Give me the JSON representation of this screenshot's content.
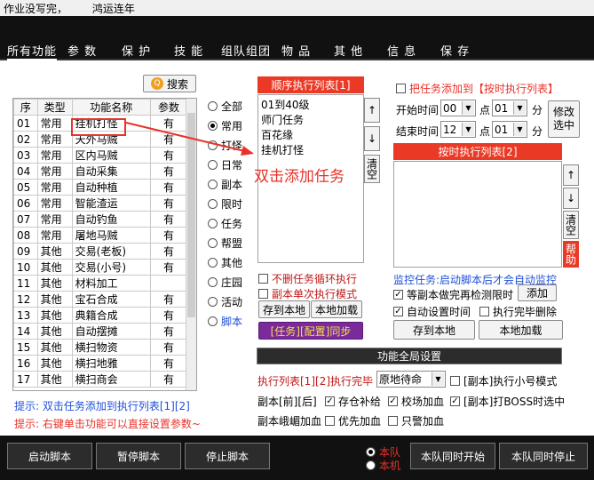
{
  "window": {
    "title_left": "作业没写完，",
    "title_right": "鸿运连年"
  },
  "tabs": [
    "所有功能",
    "参 数",
    "保 护",
    "技 能",
    "组队组团",
    "物 品",
    "其 他",
    "信 息",
    "保 存"
  ],
  "search_button": "搜索",
  "table": {
    "headers": [
      "序",
      "类型",
      "功能名称",
      "参数"
    ],
    "rows": [
      [
        "01",
        "常用",
        "挂机打怪",
        "有"
      ],
      [
        "02",
        "常用",
        "天外马贼",
        "有"
      ],
      [
        "03",
        "常用",
        "区内马贼",
        "有"
      ],
      [
        "04",
        "常用",
        "自动采集",
        "有"
      ],
      [
        "05",
        "常用",
        "自动种植",
        "有"
      ],
      [
        "06",
        "常用",
        "智能渣运",
        "有"
      ],
      [
        "07",
        "常用",
        "自动钓鱼",
        "有"
      ],
      [
        "08",
        "常用",
        "屠地马贼",
        "有"
      ],
      [
        "09",
        "其他",
        "交易(老板)",
        "有"
      ],
      [
        "10",
        "其他",
        "交易(小号)",
        "有"
      ],
      [
        "11",
        "其他",
        "材料加工",
        ""
      ],
      [
        "12",
        "其他",
        "宝石合成",
        "有"
      ],
      [
        "13",
        "其他",
        "典籍合成",
        "有"
      ],
      [
        "14",
        "其他",
        "自动摆摊",
        "有"
      ],
      [
        "15",
        "其他",
        "横扫物资",
        "有"
      ],
      [
        "16",
        "其他",
        "横扫地雅",
        "有"
      ],
      [
        "17",
        "其他",
        "横扫商会",
        "有"
      ]
    ]
  },
  "category_radios": {
    "items": [
      "全部",
      "常用",
      "打怪",
      "日常",
      "副本",
      "限时",
      "任务",
      "帮盟",
      "其他",
      "庄园",
      "活动",
      "脚本"
    ],
    "selected": "常用"
  },
  "sequence_list": {
    "title": "顺序执行列表[1]",
    "items": [
      "01到40级",
      "师门任务",
      "百花缘",
      "挂机打怪"
    ],
    "clear_label": "清空"
  },
  "annotation": {
    "text": "双击添加任务",
    "color": "#e8322a"
  },
  "timed": {
    "add_checkbox": "把任务添加到【按时执行列表】",
    "start_label": "开始时间",
    "start_hour": "00",
    "start_min": "01",
    "end_label": "结束时间",
    "end_hour": "12",
    "end_min": "01",
    "point": "点",
    "minute": "分",
    "modify_button": "修改选中",
    "list_title": "按时执行列表[2]",
    "clear_label": "清空",
    "help_label": "帮助"
  },
  "seq_options": {
    "loop": "不删任务循环执行",
    "dungeon_single": "副本单次执行模式",
    "save_local": "存到本地",
    "load_local": "本地加载",
    "sync": "[任务][配置]同步"
  },
  "monitor": {
    "title": "监控任务:启动脚本后才会自动监控",
    "wait_check": "等副本做完再检测限时",
    "add_button": "添加",
    "auto_time": "自动设置时间",
    "delete_done": "执行完毕删除",
    "save_local": "存到本地",
    "load_local": "本地加载"
  },
  "global": {
    "title": "功能全局设置",
    "exec_done_label": "执行列表[1][2]执行完毕",
    "exec_done_value": "原地待命",
    "small_mode": "[副本]执行小号模式",
    "row2_prefix": "副本[前][后]",
    "storage": "存仓补给",
    "school": "校场加血",
    "boss": "[副本]打BOSS时选中",
    "row3_prefix": "副本峨嵋加血",
    "priority": "优先加血",
    "only_warn": "只警加血"
  },
  "hints": {
    "line1": "提示: 双击任务添加到执行列表[1][2]",
    "line2": "提示: 右键单击功能可以直接设置参数~"
  },
  "bottom": {
    "start": "启动脚本",
    "pause": "暂停脚本",
    "stop": "停止脚本",
    "team": "本队",
    "machine": "本机",
    "team_start": "本队同时开始",
    "team_stop": "本队同时停止"
  },
  "colors": {
    "accent_red": "#ea3a26",
    "hint_blue": "#1f4fd8",
    "hint_red": "#e8322a",
    "sync_purple": "#7a2a9a"
  }
}
